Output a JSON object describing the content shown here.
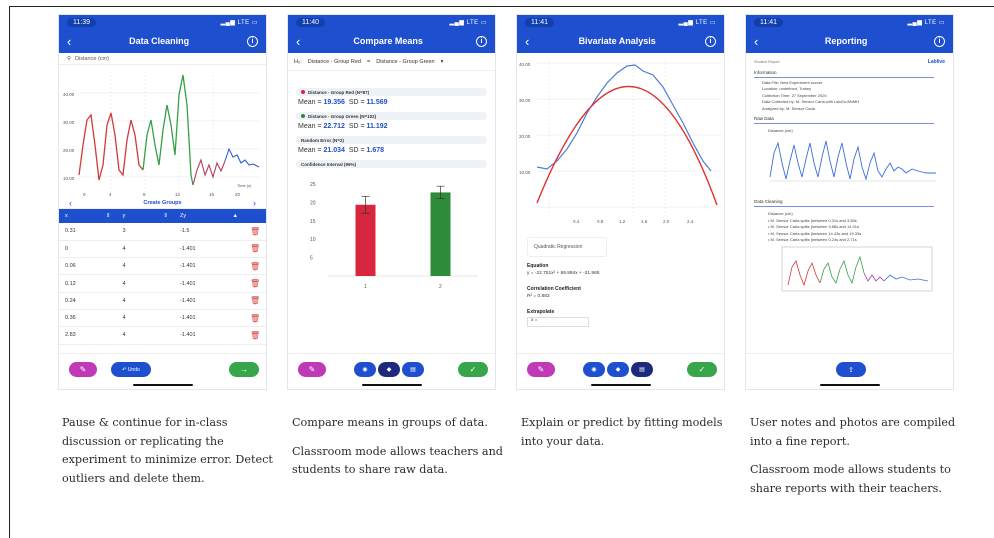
{
  "phones": [
    {
      "time": "11:39",
      "network": "LTE",
      "title": "Data Cleaning",
      "sensor_label": "Distance (cm)",
      "y_ticks": [
        "40.00",
        "30.00",
        "20.00",
        "10.00"
      ],
      "x_ticks": [
        "0",
        "4",
        "8",
        "12",
        "16",
        "20"
      ],
      "x_axis_label": "Time (s)",
      "group_nav": "Create Groups",
      "table": {
        "columns": [
          "x",
          "y",
          "Zy"
        ],
        "rows": [
          [
            "0.31",
            "3",
            "-1.5"
          ],
          [
            "0",
            "4",
            "-1.401"
          ],
          [
            "0.06",
            "4",
            "-1.401"
          ],
          [
            "0.12",
            "4",
            "-1.401"
          ],
          [
            "0.24",
            "4",
            "-1.401"
          ],
          [
            "0.36",
            "4",
            "-1.401"
          ],
          [
            "2.83",
            "4",
            "-1.401"
          ]
        ]
      },
      "undo_label": "Undo"
    },
    {
      "time": "11:40",
      "network": "LTE",
      "title": "Compare Means",
      "h0_label": "H₀:",
      "h0_left": "Distance - Group Red",
      "h0_op": "=",
      "h0_right": "Distance - Group Green",
      "groups": [
        {
          "name": "Distance - Group Red (N=87)",
          "color": "#d7263d",
          "mean": "19.356",
          "sd": "11.569"
        },
        {
          "name": "Distance - Group Green (N=102)",
          "color": "#2e8b3a",
          "mean": "22.712",
          "sd": "11.192"
        }
      ],
      "random_error_label": "Random Error (N=2)",
      "random_error_mean": "21.034",
      "random_error_sd": "1.678",
      "ci_label": "Confidence Interval (95%)",
      "mean_label": "Mean = ",
      "sd_label": "SD = ",
      "chart_data": {
        "type": "bar",
        "categories": [
          "1",
          "2"
        ],
        "values": [
          19.356,
          22.712
        ],
        "error": [
          2.3,
          1.7
        ],
        "colors": [
          "#d7263d",
          "#2e8b3a"
        ],
        "ylim": [
          0,
          25
        ],
        "yticks": [
          "25",
          "20",
          "15",
          "10",
          "5"
        ]
      }
    },
    {
      "time": "11:41",
      "network": "LTE",
      "title": "Bivariate Analysis",
      "y_ticks": [
        "40.00",
        "30.00",
        "20.00",
        "10.00"
      ],
      "x_ticks": [
        "0.4",
        "0.8",
        "1.2",
        "1.6",
        "2.0",
        "2.4"
      ],
      "model": "Quadratic Regression",
      "equation_label": "Equation",
      "equation": "y = -22.751x² + 69.894x + -21.965",
      "corr_label": "Correlation Coefficient",
      "corr_value": "R² = 0.883",
      "extrapolate_label": "Extrapolate",
      "extrapolate_x": "x ="
    },
    {
      "time": "11:41",
      "network": "LTE",
      "title": "Reporting",
      "report_tag": "Student Report",
      "logo_text": "Lablive",
      "info_head": "Information",
      "info_lines": [
        "Data File: New Experiment soccer",
        "Location: undefined, Turkey",
        "Collection Time: 27 September 2020",
        "Data Collected by: M. Sensor Carla with LabGo-BNMH",
        "Analyzed by: M. Sensor Carla"
      ],
      "raw_head": "Raw Data",
      "raw_chart_title": "Distance (cm)",
      "cleaning_head": "Data Cleaning",
      "cleaning_chart_title": "Distance (cm)",
      "cleaning_lines": [
        "M. Sensor Carla splits (between 0.31s and 3.83s",
        "M. Sensor Carla splits (between 3.88s and 14.31s",
        "M. Sensor Carla splits (between 14.43s and 19.33s",
        "M. Sensor Carla splits (between 0.24s and 2.71s"
      ]
    }
  ],
  "captions": [
    [
      "Pause & continue for in-class discussion or replicating the experiment to minimize error. Detect outliers and delete them."
    ],
    [
      "Compare means in groups of data.",
      "Classroom mode allows teachers and students to share raw data."
    ],
    [
      "Explain or predict by fitting models into your data."
    ],
    [
      "User notes and photos are compiled into a fine report.",
      "Classroom mode allows students to share reports with their teachers."
    ]
  ],
  "colors": {
    "nav_blue": "#1e4fcf",
    "purple": "#c03ab7",
    "green": "#37a54a",
    "navy": "#1d2a7c"
  }
}
